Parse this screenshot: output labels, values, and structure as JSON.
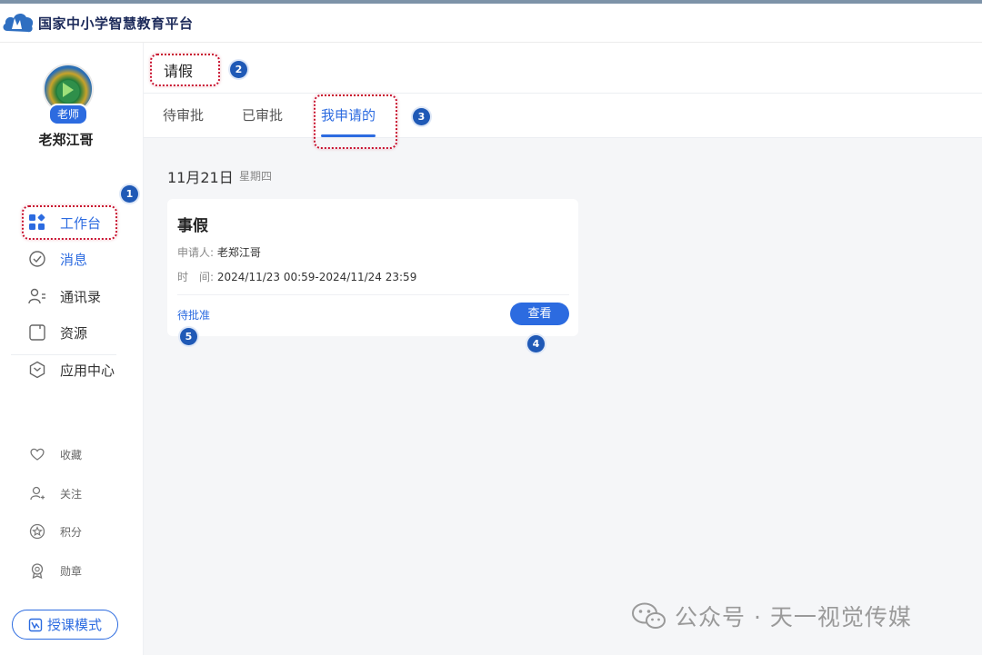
{
  "header": {
    "logo_icon": "cloud-logo-icon",
    "brand_title": "国家中小学智慧教育平台"
  },
  "sidebar": {
    "avatar_icon": "avatar-icon",
    "role_badge": "老师",
    "username": "老郑江哥",
    "menu": [
      {
        "label": "工作台",
        "icon": "dashboard-icon",
        "active": true
      },
      {
        "label": "消息",
        "icon": "message-icon"
      },
      {
        "label": "通讯录",
        "icon": "contacts-icon"
      },
      {
        "label": "资源",
        "icon": "resource-icon"
      },
      {
        "label": "应用中心",
        "icon": "app-center-icon"
      }
    ],
    "secondary": [
      {
        "label": "收藏",
        "icon": "heart-icon"
      },
      {
        "label": "关注",
        "icon": "follow-icon"
      },
      {
        "label": "积分",
        "icon": "points-icon"
      },
      {
        "label": "勋章",
        "icon": "medal-icon"
      }
    ],
    "mode_button": "授课模式"
  },
  "page": {
    "title": "请假",
    "tabs": [
      {
        "label": "待审批"
      },
      {
        "label": "已审批"
      },
      {
        "label": "我申请的",
        "active": true
      }
    ],
    "date": "11月21日",
    "weekday": "星期四",
    "card": {
      "title": "事假",
      "applicant_label": "申请人:",
      "applicant": "老郑江哥",
      "time_label": "时　间:",
      "time_value": "2024/11/23 00:59-2024/11/24 23:59",
      "status": "待批准",
      "view_button": "查看"
    }
  },
  "annotations": {
    "markers": [
      "1",
      "2",
      "3",
      "4",
      "5"
    ],
    "highlight_color": "#c8102e",
    "marker_color": "#1f59b6"
  },
  "watermark": {
    "icon": "wechat-icon",
    "text": "公众号 · 天一视觉传媒"
  },
  "colors": {
    "accent": "#2c6be0",
    "background": "#f5f6f8"
  }
}
